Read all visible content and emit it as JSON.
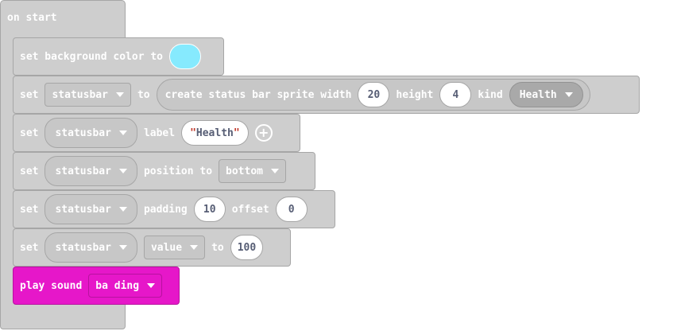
{
  "on_start": {
    "label": "on start"
  },
  "blocks": {
    "bg": {
      "text": "set background color to",
      "color": "#86eafe"
    },
    "create": {
      "set": "set",
      "var": "statusbar",
      "to": "to",
      "fn": "create status bar sprite width",
      "width": "20",
      "height_label": "height",
      "height": "4",
      "kind_label": "kind",
      "kind": "Health"
    },
    "label": {
      "set": "set",
      "var": "statusbar",
      "prop": "label",
      "quote_open": "\"",
      "value": "Health",
      "quote_close": "\"",
      "add_icon": "plus-circle-icon"
    },
    "position": {
      "set": "set",
      "var": "statusbar",
      "prop": "position to",
      "value": "bottom"
    },
    "padding": {
      "set": "set",
      "var": "statusbar",
      "prop": "padding",
      "padding": "10",
      "offset_label": "offset",
      "offset": "0"
    },
    "value": {
      "set": "set",
      "var": "statusbar",
      "prop": "value",
      "to": "to",
      "value": "100"
    },
    "sound": {
      "text": "play sound",
      "sound": "ba ding",
      "color": "#e617c9"
    }
  },
  "colors": {
    "block_gray": "#cecece",
    "music_pink": "#e617c9"
  }
}
